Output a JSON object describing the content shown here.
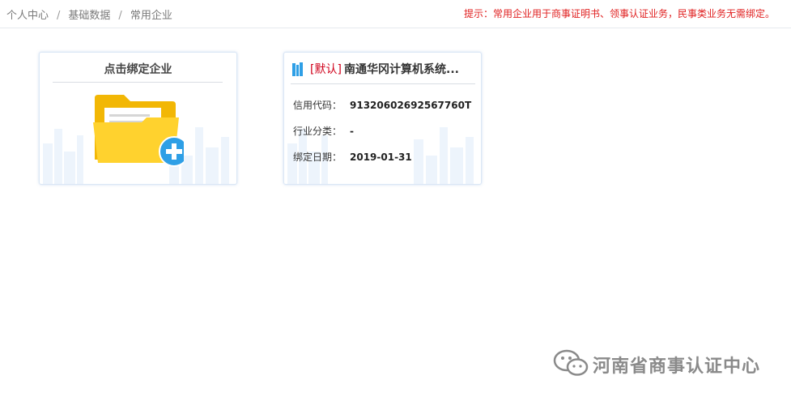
{
  "breadcrumb": {
    "items": [
      "个人中心",
      "基础数据",
      "常用企业"
    ],
    "separator": "/"
  },
  "notice": "提示：常用企业用于商事证明书、领事认证业务，民事类业务无需绑定。",
  "bind_card": {
    "title": "点击绑定企业",
    "icon": "folder-add-icon"
  },
  "company_card": {
    "tag": "[默认]",
    "name": "南通华冈计算机系统...",
    "rows": [
      {
        "label": "信用代码：",
        "value": "91320602692567760T"
      },
      {
        "label": "行业分类：",
        "value": "-"
      },
      {
        "label": "绑定日期：",
        "value": "2019-01-31"
      }
    ]
  },
  "watermark": {
    "text": "河南省商事认证中心"
  },
  "colors": {
    "notice": "#e02020",
    "tag": "#d0021b",
    "accent": "#2e9fe6",
    "folder": "#f8c417"
  }
}
